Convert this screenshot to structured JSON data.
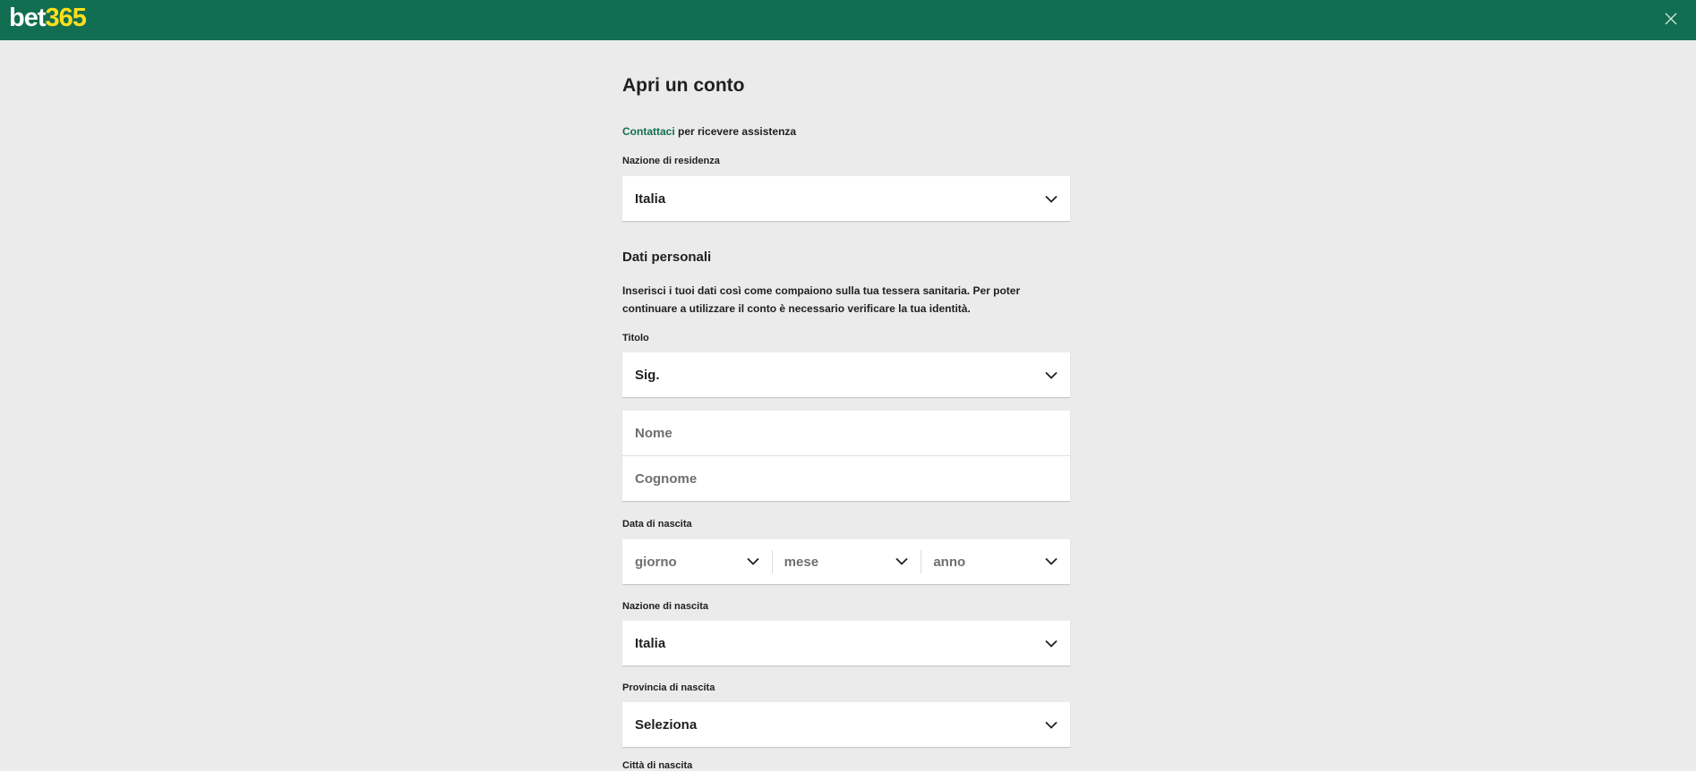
{
  "header": {
    "logo_part1": "bet",
    "logo_part2": "365",
    "brand_color": "#126e51",
    "logo_accent_color": "#ffdf1b",
    "close_icon": "close-icon"
  },
  "page": {
    "title": "Apri un conto",
    "help_link": "Contattaci",
    "help_text": " per ricevere assistenza"
  },
  "residence": {
    "label": "Nazione di residenza",
    "value": "Italia"
  },
  "personal": {
    "title": "Dati personali",
    "intro": "Inserisci i tuoi dati così come compaiono sulla tua tessera sanitaria. Per poter continuare a utilizzare il conto è necessario verificare la tua identità.",
    "title_label": "Titolo",
    "title_value": "Sig.",
    "first_name_placeholder": "Nome",
    "last_name_placeholder": "Cognome"
  },
  "birth_date": {
    "label": "Data di nascita",
    "day_placeholder": "giorno",
    "month_placeholder": "mese",
    "year_placeholder": "anno"
  },
  "birth_country": {
    "label": "Nazione di nascita",
    "value": "Italia"
  },
  "birth_province": {
    "label": "Provincia di nascita",
    "value": "Seleziona"
  },
  "birth_city": {
    "label": "Città di nascita"
  }
}
